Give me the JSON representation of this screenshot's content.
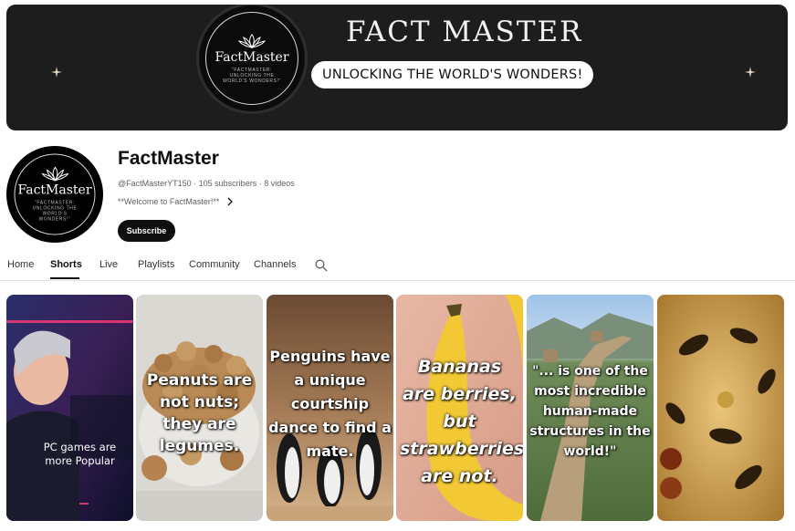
{
  "banner": {
    "title": "FACT MASTER",
    "tagline": "UNLOCKING THE WORLD'S WONDERS!",
    "logo_name": "FactMaster",
    "logo_tag": "\"FACTMASTER: UNLOCKING THE WORLD'S WONDERS!\""
  },
  "channel": {
    "name": "FactMaster",
    "handle": "@FactMasterYT150",
    "subscribers": "105 subscribers",
    "videos": "8 videos",
    "meta": "@FactMasterYT150 · 105 subscribers · 8 videos",
    "description": "**Welcome to FactMaster!**",
    "subscribe_label": "Subscribe",
    "avatar_name": "FactMaster",
    "avatar_tag": "\"FACTMASTER: UNLOCKING THE WORLD'S WONDERS!\""
  },
  "tabs": [
    "Home",
    "Shorts",
    "Live",
    "Playlists",
    "Community",
    "Channels"
  ],
  "active_tab": "Shorts",
  "shorts": [
    {
      "text": "PC games are more Popular"
    },
    {
      "text": "Peanuts are not nuts; they are legumes."
    },
    {
      "text": "Penguins have a unique courtship dance to find a mate."
    },
    {
      "text": "Bananas are berries, but strawberries are not."
    },
    {
      "text": "\"... is one of the most incredible human-made structures in the world!\""
    },
    {
      "text": ""
    }
  ],
  "icons": {
    "search": "search-icon",
    "sparkle": "sparkle-icon",
    "chevron": "chevron-right-icon"
  },
  "colors": {
    "banner_bg": "#1d1d1d",
    "subscribe_bg": "#0f0f0f",
    "text_secondary": "#606060"
  }
}
